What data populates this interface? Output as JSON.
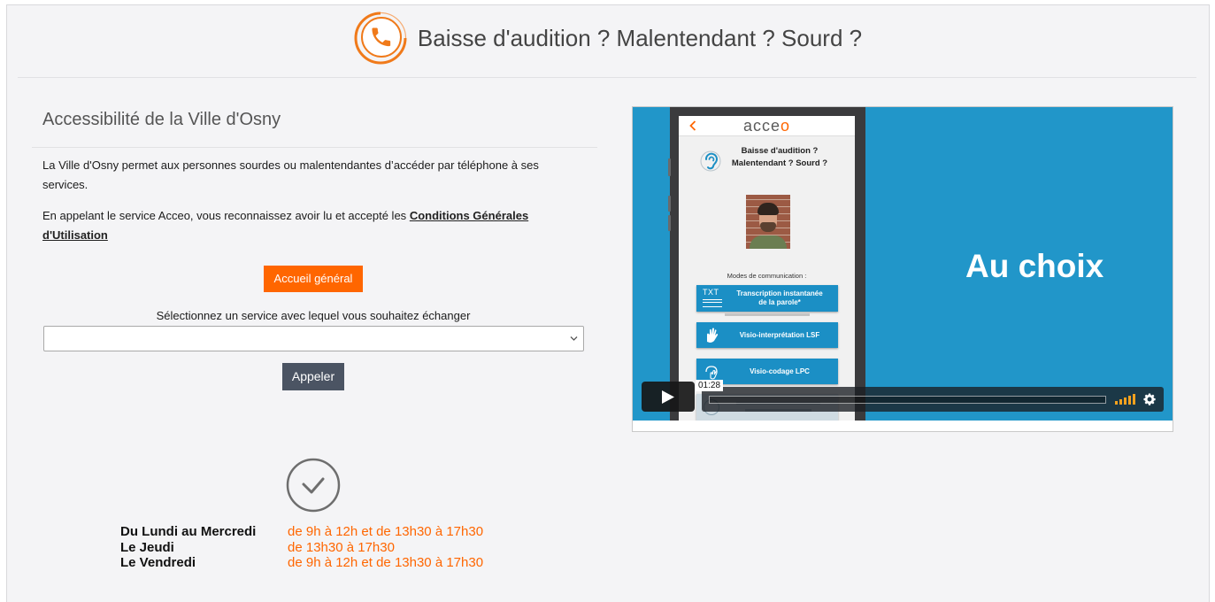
{
  "header": {
    "title": "Baisse d'audition ? Malentendant ? Sourd ?",
    "logo_icon": "phone-circle-icon"
  },
  "accessibility": {
    "title": "Accessibilité de la Ville d'Osny",
    "intro": "La Ville d'Osny permet aux personnes sourdes ou malentendantes d’accéder par téléphone à ses services.",
    "terms_text": "En appelant le service Acceo, vous reconnaissez avoir lu et accepté les",
    "terms_link": "Conditions Générales d'Utilisation"
  },
  "general_button": "Accueil général",
  "service_select": {
    "label": "Sélectionnez un service avec lequel vous souhaitez échanger",
    "selected": "",
    "icon": "chevron-down-icon"
  },
  "call_button": "Appeler",
  "hours": {
    "icon": "check-circle-icon",
    "rows": [
      {
        "days": "Du Lundi au Mercredi",
        "time": "de 9h à 12h et de 13h30 à 17h30"
      },
      {
        "days": "Le Jeudi",
        "time": "de 13h30 à 17h30"
      },
      {
        "days": "Le Vendredi",
        "time": "de 9h à 12h et de 13h30 à 17h30"
      }
    ]
  },
  "video": {
    "headline": "Au choix",
    "duration": "01:28",
    "progress": 0,
    "volume": 1,
    "play_icon": "play-icon",
    "volume_icon": "volume-bars-icon",
    "settings_icon": "gear-icon",
    "app": {
      "back_icon": "chevron-left-icon",
      "logo_main": "acce",
      "logo_accent": "o",
      "ear_icon": "ear-icon",
      "heading_line1": "Baisse d'audition ?",
      "heading_line2": "Malentendant ? Sourd ?",
      "modes_label": "Modes de communication :",
      "modes": [
        {
          "icon": "txt-icon",
          "icon_text": "TXT",
          "label_line1": "Transcription instantanée",
          "label_line2": "de la parole*"
        },
        {
          "icon": "sign-language-hand-icon",
          "label_line1": "Visio-interprétation LSF"
        },
        {
          "icon": "cued-speech-icon",
          "label_line1": "Visio-codage LPC"
        }
      ]
    }
  },
  "colors": {
    "accent": "#ff6600",
    "page_background": "#f4f4f6",
    "call_button": "#4b5463",
    "video_background": "#2196c9",
    "app_button": "#1b8fc5",
    "volume": "#f4a21e"
  }
}
